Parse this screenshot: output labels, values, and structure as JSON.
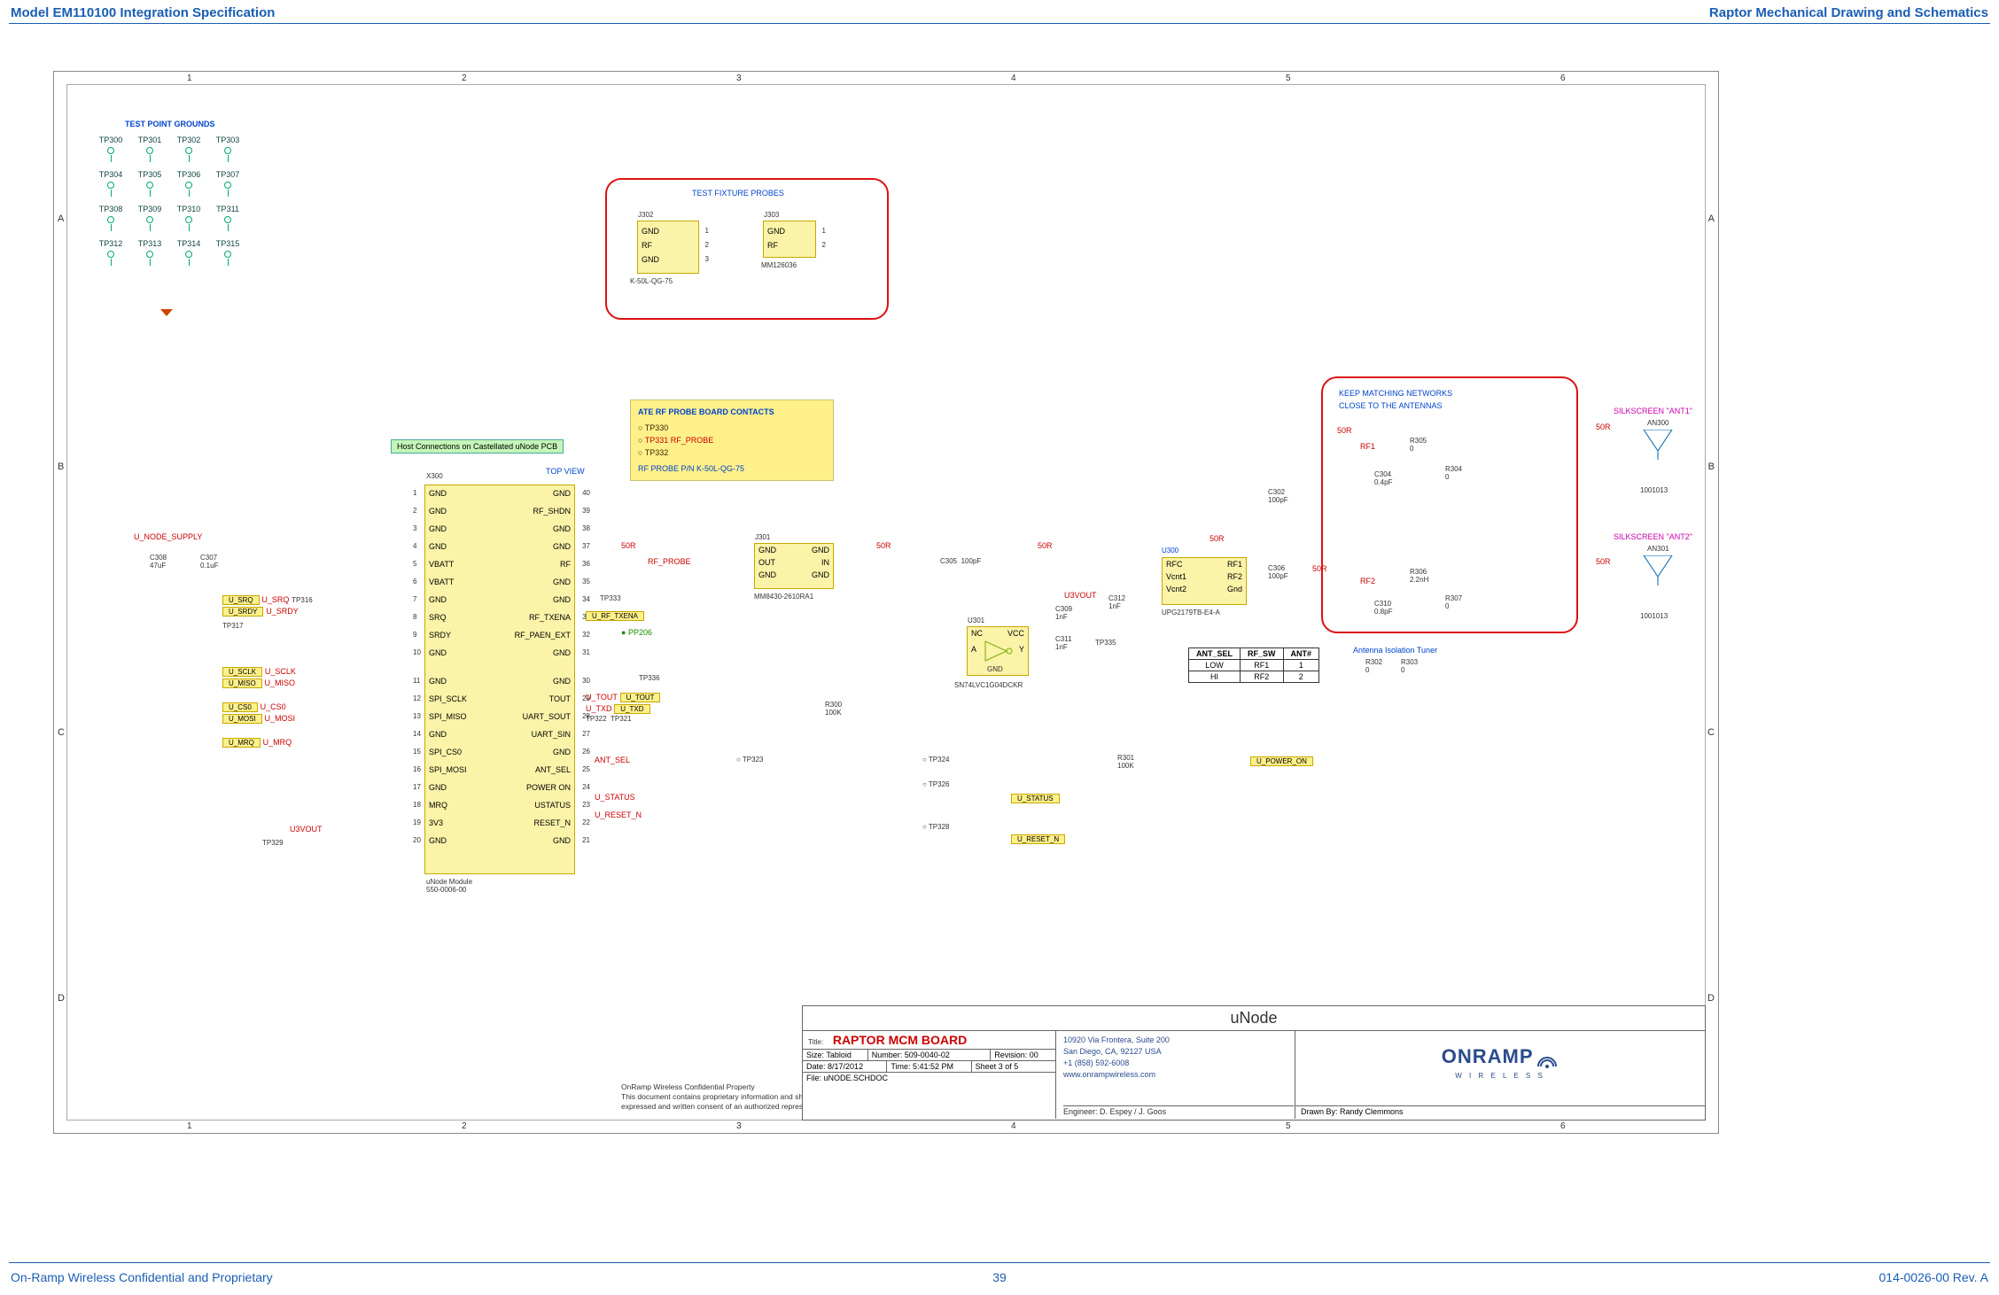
{
  "header": {
    "left": "Model EM110100 Integration Specification",
    "right": "Raptor Mechanical Drawing and Schematics"
  },
  "footer": {
    "left": "On-Ramp Wireless Confidential and Proprietary",
    "center": "39",
    "right": "014-0026-00 Rev. A"
  },
  "grid_cols": [
    "1",
    "2",
    "3",
    "4",
    "5",
    "6"
  ],
  "grid_rows": [
    "A",
    "B",
    "C",
    "D"
  ],
  "tp_section": {
    "title": "TEST POINT GROUNDS",
    "rows": [
      [
        "TP300",
        "TP301",
        "TP302",
        "TP303"
      ],
      [
        "TP304",
        "TP305",
        "TP306",
        "TP307"
      ],
      [
        "TP308",
        "TP309",
        "TP310",
        "TP311"
      ],
      [
        "TP312",
        "TP313",
        "TP314",
        "TP315"
      ]
    ]
  },
  "test_fixture": {
    "title": "TEST FIXTURE PROBES",
    "j302": {
      "ref": "J302",
      "pins": [
        "GND",
        "RF",
        "GND"
      ],
      "pn": "K-50L-QG-75"
    },
    "j303": {
      "ref": "J303",
      "pins": [
        "GND",
        "RF"
      ],
      "pn": "MM126036"
    }
  },
  "ate_box": {
    "title": "ATE RF PROBE BOARD CONTACTS",
    "lines": [
      "TP330",
      "TP331    RF_PROBE",
      "TP332",
      "RF PROBE P/N K-50L-QG-75"
    ]
  },
  "host_note": "Host Connections on Castellated uNode PCB",
  "top_view": "TOP VIEW",
  "x300": {
    "ref": "X300",
    "sub": "uNode Module\n550-0006-00",
    "left": [
      "GND",
      "GND",
      "GND",
      "GND",
      "VBATT",
      "VBATT",
      "GND",
      "SRQ",
      "SRDY",
      "GND",
      "",
      "GND",
      "SPI_SCLK",
      "SPI_MISO",
      "GND",
      "SPI_CS0",
      "SPI_MOSI",
      "GND",
      "MRQ",
      "3V3",
      "GND"
    ],
    "right": [
      "GND",
      "RF_SHDN",
      "GND",
      "GND",
      "RF",
      "GND",
      "GND",
      "RF_TXENA",
      "RF_PAEN_EXT",
      "GND",
      "",
      "GND",
      "TOUT",
      "UART_SOUT",
      "UART_SIN",
      "GND",
      "ANT_SEL",
      "POWER ON",
      "USTATUS",
      "RESET_N",
      "GND"
    ],
    "left_nums": [
      "1",
      "2",
      "3",
      "4",
      "5",
      "6",
      "7",
      "8",
      "9",
      "10",
      "",
      "11",
      "12",
      "13",
      "14",
      "15",
      "16",
      "17",
      "18",
      "19",
      "20"
    ],
    "right_nums": [
      "40",
      "39",
      "38",
      "37",
      "36",
      "35",
      "34",
      "33",
      "32",
      "31",
      "",
      "30",
      "29",
      "28",
      "27",
      "26",
      "25",
      "24",
      "23",
      "22",
      "21"
    ]
  },
  "left_signals": {
    "supply": "U_NODE_SUPPLY",
    "caps": [
      {
        "ref": "C308",
        "val": "47uF"
      },
      {
        "ref": "C307",
        "val": "0.1uF"
      }
    ],
    "rows": [
      "U_SRQ",
      "U_SRDY",
      "",
      "U_SCLK",
      "U_MISO",
      "",
      "U_CS0",
      "U_MOSI",
      "",
      "U_MRQ"
    ],
    "tp_inline": [
      "TP316",
      "TP317",
      "TP329"
    ],
    "u3vout": "U3VOUT",
    "nets": [
      "U_SRQ",
      "U_SRDY",
      "U_SCLK",
      "U_MISO",
      "U_CS0",
      "U_MOSI",
      "U_MRQ"
    ]
  },
  "mid_signals": {
    "pp206": "PP206",
    "tp333": "TP333",
    "tp336": "TP336",
    "tp321": "TP321",
    "tp322": "TP322",
    "tp323": "TP323",
    "nets_right": [
      "U_RF_TXENA",
      "U_TOUT",
      "U_TXD",
      "ANT_SEL",
      "U_STATUS",
      "U_RESET_N"
    ],
    "rf_probe": "RF_PROBE",
    "fifty_r": "50R"
  },
  "j301": {
    "ref": "J301",
    "pins": [
      "GND",
      "OUT",
      "GND",
      "GND",
      "IN",
      "GND"
    ],
    "pn": "MM8430-2610RA1"
  },
  "c305": {
    "ref": "C305",
    "val": "100pF"
  },
  "r300": {
    "ref": "R300",
    "val": "100K"
  },
  "r301": {
    "ref": "R301",
    "val": "100K"
  },
  "u3vout_mid": "U3VOUT",
  "c309": {
    "ref": "C309",
    "val": "1nF"
  },
  "c311": {
    "ref": "C311",
    "val": "1nF"
  },
  "c312": {
    "ref": "C312",
    "val": "1nF"
  },
  "c302": {
    "ref": "C302",
    "val": "100pF"
  },
  "c306": {
    "ref": "C306",
    "val": "100pF"
  },
  "tp_mid": [
    "TP324",
    "TP326",
    "TP328",
    "TP335"
  ],
  "right_bus": [
    "U_POWER_ON",
    "U_STATUS",
    "U_RESET_N"
  ],
  "u301": {
    "ref": "U301",
    "pn": "SN74LVC1G04DCKR",
    "pins": [
      "NC",
      "A",
      "GND",
      "Y",
      "VCC"
    ]
  },
  "u300": {
    "ref": "U300",
    "pn": "UPG2179TB-E4-A",
    "pins": [
      "RFC",
      "Vcnt1",
      "Vcnt2",
      "RF1",
      "RF2",
      "Gnd"
    ]
  },
  "match_note": {
    "l1": "KEEP MATCHING NETWORKS",
    "l2": "CLOSE TO THE ANTENNAS"
  },
  "ant1": {
    "silks": "SILKSCREEN \"ANT1\"",
    "ref": "AN300",
    "pn": "1001013"
  },
  "ant2": {
    "silks": "SILKSCREEN \"ANT2\"",
    "ref": "AN301",
    "pn": "1001013"
  },
  "r305": {
    "ref": "R305",
    "val": "0"
  },
  "r304": {
    "ref": "R304",
    "val": "0"
  },
  "c304": {
    "ref": "C304",
    "val": "0.4pF"
  },
  "r306": {
    "ref": "R306",
    "val": "2.2nH"
  },
  "r307": {
    "ref": "R307",
    "val": "0"
  },
  "c310": {
    "ref": "C310",
    "val": "0.8pF"
  },
  "rf_labels": {
    "rf1": "RF1",
    "rf2": "RF2"
  },
  "tuner": {
    "title": "Antenna Isolation Tuner",
    "r302": "R302",
    "r303": "R303",
    "val": "0"
  },
  "ant_table": {
    "headers": [
      "ANT_SEL",
      "RF_SW",
      "ANT#"
    ],
    "rows": [
      [
        "LOW",
        "RF1",
        "1"
      ],
      [
        "HI",
        "RF2",
        "2"
      ]
    ]
  },
  "title_block": {
    "sheet_title": "uNode",
    "title_label": "Title:",
    "title": "RAPTOR MCM BOARD",
    "size_label": "Size:",
    "size": "Tabloid",
    "num_label": "Number:",
    "number": "509-0040-02",
    "rev_label": "Revision:",
    "revision": "00",
    "date_label": "Date:",
    "date": "8/17/2012",
    "time_label": "Time:",
    "time": "5:41:52 PM",
    "sheet_label": "Sheet",
    "sheet": "3  of  5",
    "file_label": "File:",
    "file": "uNODE.SCHDOC",
    "eng_label": "Engineer:",
    "engineer": "D. Espey / J. Goos",
    "addr_l1": "10920 Via Frontera, Suite 200",
    "addr_l2": "San Diego, CA, 92127 USA",
    "addr_l3": "+1 (858) 592-6008",
    "addr_l4": "www.onrampwireless.com",
    "drawn_label": "Drawn By:",
    "drawn": "Randy Clemmons",
    "logo": "ONRAMP",
    "logo_sub": "W I R E L E S S"
  },
  "disclaimer": {
    "l1": "OnRamp Wireless Confidential Property",
    "l2": "This document contains proprietary information and shall not be disclosed in whole or in part to any party without the expressed and written consent of an authorized representative of Onramp Wireless Inc."
  },
  "misc_50r": "50R"
}
